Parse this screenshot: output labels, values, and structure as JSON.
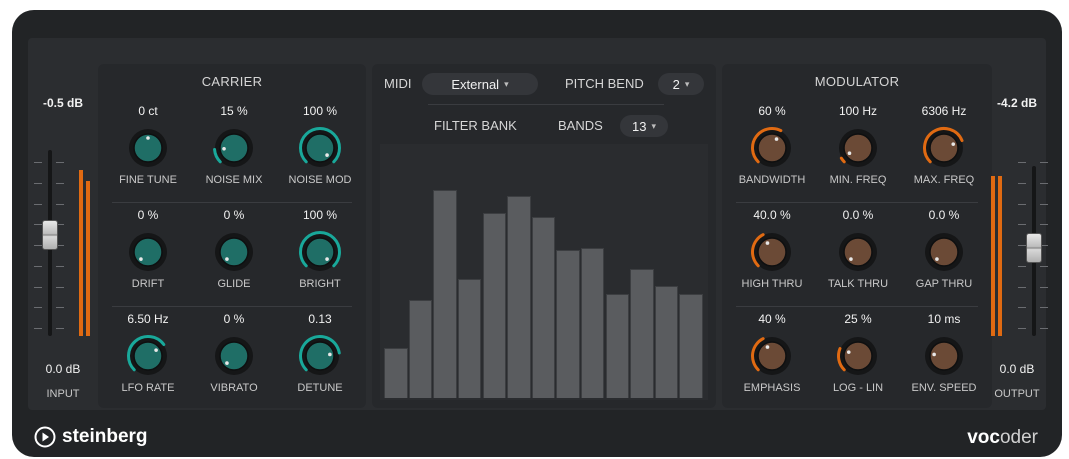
{
  "brand": "steinberg",
  "product": {
    "bold": "voc",
    "light": "oder"
  },
  "input": {
    "peak": "-0.5 dB",
    "value": "0.0 dB",
    "label": "INPUT",
    "level": 0.85
  },
  "output": {
    "peak": "-4.2 dB",
    "value": "0.0 dB",
    "label": "OUTPUT",
    "level": 0.85
  },
  "carrier": {
    "title": "CARRIER",
    "knobs": [
      {
        "label": "FINE TUNE",
        "value": "0 ct",
        "pos": 0.5,
        "ring": 0,
        "ringFrom": 0
      },
      {
        "label": "NOISE MIX",
        "value": "15 %",
        "pos": 0.15,
        "ring": 0.15,
        "ringFrom": 0
      },
      {
        "label": "NOISE MOD",
        "value": "100 %",
        "pos": 1.0,
        "ring": 1.0,
        "ringFrom": 0
      },
      {
        "label": "DRIFT",
        "value": "0 %",
        "pos": 0.0,
        "ring": 0,
        "ringFrom": 0
      },
      {
        "label": "GLIDE",
        "value": "0 %",
        "pos": 0.0,
        "ring": 0,
        "ringFrom": 0
      },
      {
        "label": "BRIGHT",
        "value": "100 %",
        "pos": 1.0,
        "ring": 1.0,
        "ringFrom": 0
      },
      {
        "label": "LFO RATE",
        "value": "6.50 Hz",
        "pos": 0.7,
        "ring": 0.7,
        "ringFrom": 0
      },
      {
        "label": "VIBRATO",
        "value": "0 %",
        "pos": 0.0,
        "ring": 0,
        "ringFrom": 0
      },
      {
        "label": "DETUNE",
        "value": "0.13",
        "pos": 0.8,
        "ring": 0.8,
        "ringFrom": 0
      }
    ]
  },
  "modulator": {
    "title": "MODULATOR",
    "knobs": [
      {
        "label": "BANDWIDTH",
        "value": "60 %",
        "pos": 0.6,
        "ring": 0.6,
        "ringFrom": 0
      },
      {
        "label": "MIN. FREQ",
        "value": "100 Hz",
        "pos": 0.05,
        "ring": 0.05,
        "ringFrom": 0
      },
      {
        "label": "MAX. FREQ",
        "value": "6306 Hz",
        "pos": 0.75,
        "ring": 0.75,
        "ringFrom": 0
      },
      {
        "label": "HIGH THRU",
        "value": "40.0 %",
        "pos": 0.4,
        "ring": 0.4,
        "ringFrom": 0
      },
      {
        "label": "TALK THRU",
        "value": "0.0 %",
        "pos": 0.0,
        "ring": 0,
        "ringFrom": 0
      },
      {
        "label": "GAP THRU",
        "value": "0.0 %",
        "pos": 0.0,
        "ring": 0,
        "ringFrom": 0
      },
      {
        "label": "EMPHASIS",
        "value": "40 %",
        "pos": 0.4,
        "ring": 0.4,
        "ringFrom": 0
      },
      {
        "label": "LOG - LIN",
        "value": "25 %",
        "pos": 0.25,
        "ring": 0.25,
        "ringFrom": 0
      },
      {
        "label": "ENV. SPEED",
        "value": "10 ms",
        "pos": 0.2,
        "ring": 0,
        "ringFrom": 0
      }
    ]
  },
  "midi": {
    "label": "MIDI",
    "value": "External"
  },
  "pitch_bend": {
    "label": "PITCH BEND",
    "value": "2"
  },
  "filter_bank": {
    "label": "FILTER BANK"
  },
  "bands": {
    "label": "BANDS",
    "value": "13"
  },
  "band_levels": [
    0.24,
    0.47,
    1.0,
    0.57,
    0.89,
    0.97,
    0.87,
    0.71,
    0.72,
    0.5,
    0.62,
    0.54,
    0.5
  ],
  "colors": {
    "carrier": "#19a89a",
    "modulator": "#e06a12",
    "knobCarrier": "#1f6e66",
    "knobModulator": "#6b4a36"
  }
}
